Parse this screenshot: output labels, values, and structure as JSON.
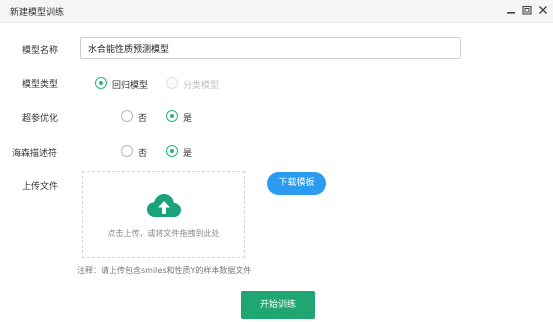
{
  "window": {
    "title": "新建模型训练",
    "minimize_icon": "minimize-icon",
    "maximize_icon": "restore-icon",
    "close_icon": "close-icon"
  },
  "form": {
    "model_name": {
      "label": "模型名称",
      "value": "水合能性质预测模型"
    },
    "model_type": {
      "label": "模型类型",
      "options": [
        {
          "label": "回归模型",
          "checked": true,
          "disabled": false
        },
        {
          "label": "分类模型",
          "checked": false,
          "disabled": true
        }
      ]
    },
    "hyperparam": {
      "label": "超参优化",
      "options": [
        {
          "label": "否",
          "checked": false
        },
        {
          "label": "是",
          "checked": true
        }
      ]
    },
    "hash_descriptor": {
      "label": "海森描述符",
      "options": [
        {
          "label": "否",
          "checked": false
        },
        {
          "label": "是",
          "checked": true
        }
      ]
    },
    "upload": {
      "label": "上传文件",
      "icon": "cloud-upload-icon",
      "hint": "点击上传，或将文件拖拽到此处",
      "download_label": "下载模板",
      "note": "注释：请上传包含smiles和性质Y的样本数据文件"
    },
    "start_label": "开始训练"
  },
  "colors": {
    "accent": "#2bb37b",
    "primary": "#1fa672",
    "download": "#2b9bf0"
  }
}
